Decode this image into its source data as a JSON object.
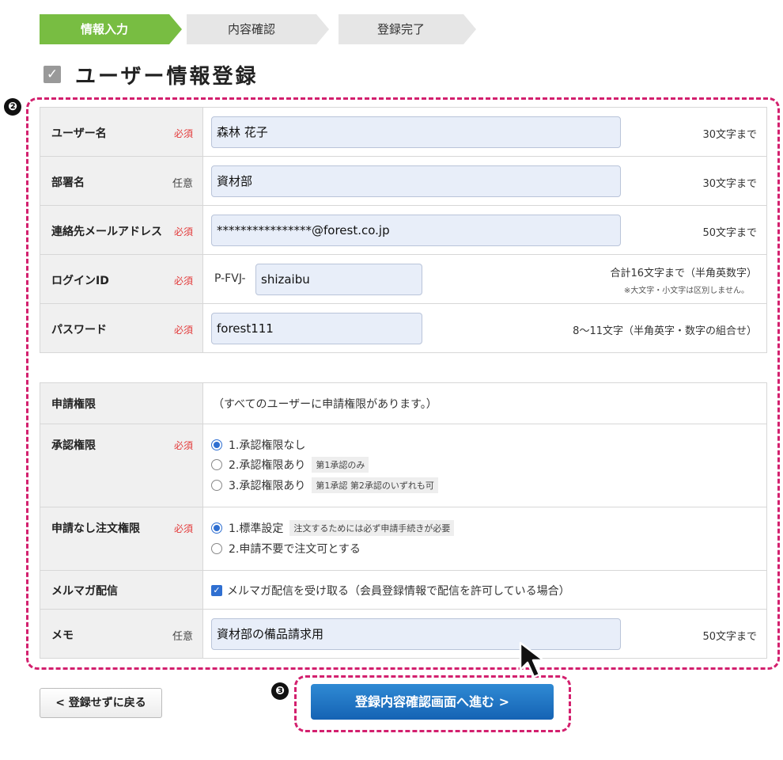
{
  "steps": [
    {
      "label": "情報入力",
      "state": "active"
    },
    {
      "label": "内容確認",
      "state": "inactive"
    },
    {
      "label": "登録完了",
      "state": "inactive"
    }
  ],
  "title": "ユーザー情報登録",
  "markers": {
    "form": "❷",
    "button": "❸"
  },
  "fields": {
    "username": {
      "label": "ユーザー名",
      "req": "必須",
      "value": "森林 花子",
      "limit": "30文字まで"
    },
    "department": {
      "label": "部署名",
      "req": "任意",
      "value": "資材部",
      "limit": "30文字まで"
    },
    "email": {
      "label": "連絡先メールアドレス",
      "req": "必須",
      "value": "****************@forest.co.jp",
      "limit": "50文字まで"
    },
    "login_id": {
      "label": "ログインID",
      "req": "必須",
      "prefix": "P-FVJ-",
      "value": "shizaibu",
      "limit": "合計16文字まで（半角英数字）",
      "note": "※大文字・小文字は区別しません。"
    },
    "password": {
      "label": "パスワード",
      "req": "必須",
      "value": "forest111",
      "limit": "8〜11文字（半角英字・数字の組合せ）"
    },
    "apply_perm": {
      "label": "申請権限",
      "text": "（すべてのユーザーに申請権限があります。）"
    },
    "approve_perm": {
      "label": "承認権限",
      "req": "必須",
      "options": [
        {
          "text": "1.承認権限なし",
          "tag": "",
          "selected": true
        },
        {
          "text": "2.承認権限あり",
          "tag": "第1承認のみ",
          "selected": false
        },
        {
          "text": "3.承認権限あり",
          "tag": "第1承認 第2承認のいずれも可",
          "selected": false
        }
      ]
    },
    "order_perm": {
      "label": "申請なし注文権限",
      "req": "必須",
      "options": [
        {
          "text": "1.標準設定",
          "tag": "注文するためには必ず申請手続きが必要",
          "selected": true
        },
        {
          "text": "2.申請不要で注文可とする",
          "tag": "",
          "selected": false
        }
      ]
    },
    "newsletter": {
      "label": "メルマガ配信",
      "text": "メルマガ配信を受け取る（会員登録情報で配信を許可している場合）",
      "checked": true
    },
    "memo": {
      "label": "メモ",
      "req": "任意",
      "value": "資材部の備品請求用",
      "limit": "50文字まで"
    }
  },
  "buttons": {
    "back": "< 登録せずに戻る",
    "next": "登録内容確認画面へ進む >"
  },
  "colors": {
    "accent_green": "#78bd42",
    "frame_magenta": "#d3206e",
    "button_blue": "#1d6fc0",
    "required_red": "#e33a3a"
  }
}
